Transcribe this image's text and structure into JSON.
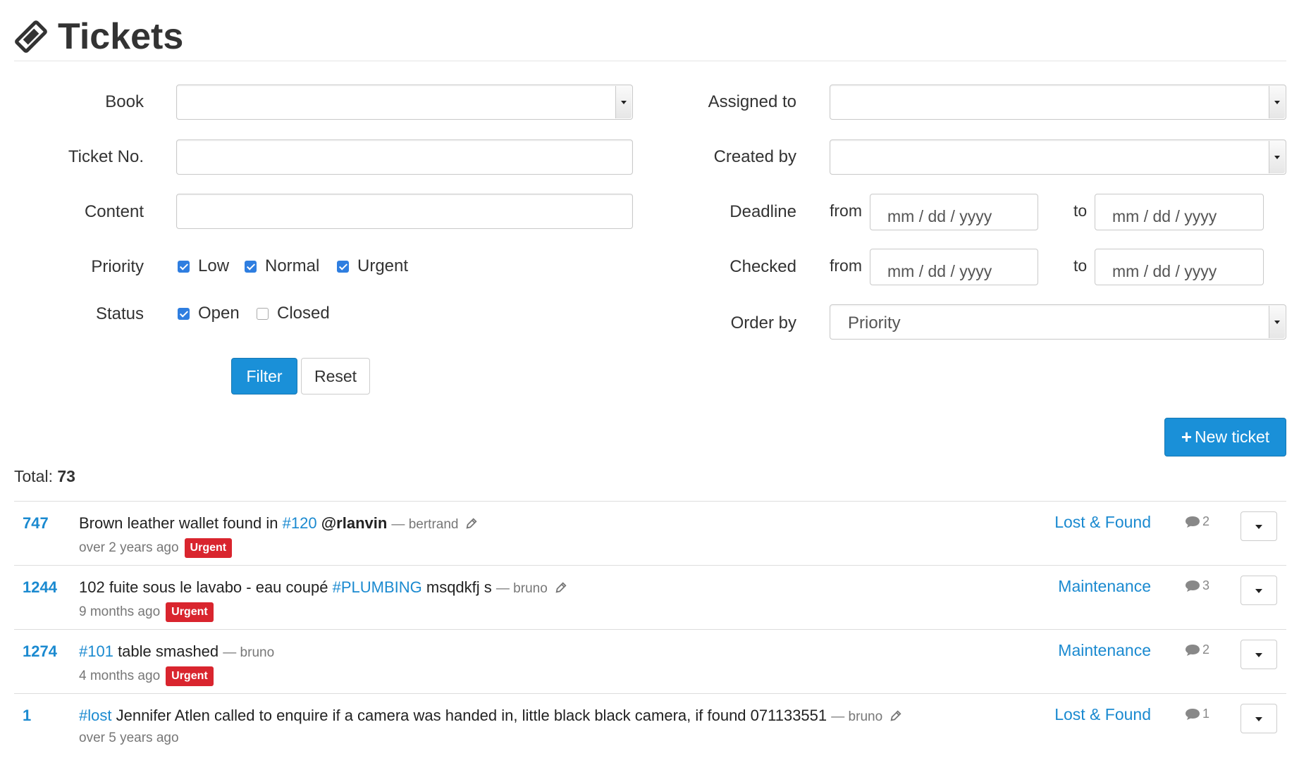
{
  "header": {
    "title": "Tickets",
    "icon": "ticket-icon"
  },
  "filters": {
    "book_label": "Book",
    "ticket_no_label": "Ticket No.",
    "content_label": "Content",
    "priority_label": "Priority",
    "status_label": "Status",
    "assigned_to_label": "Assigned to",
    "created_by_label": "Created by",
    "deadline_label": "Deadline",
    "checked_label": "Checked",
    "order_by_label": "Order by",
    "order_by_value": "Priority",
    "from_label": "from",
    "to_label": "to",
    "date_placeholder": "mm / dd / yyyy",
    "priority_options": [
      {
        "label": "Low",
        "checked": true
      },
      {
        "label": "Normal",
        "checked": true
      },
      {
        "label": "Urgent",
        "checked": true
      }
    ],
    "status_options": [
      {
        "label": "Open",
        "checked": true
      },
      {
        "label": "Closed",
        "checked": false
      }
    ],
    "filter_button": "Filter",
    "reset_button": "Reset"
  },
  "new_ticket_button": "New ticket",
  "total_label": "Total:",
  "total_value": "73",
  "tickets": [
    {
      "number": "747",
      "text": "Brown leather wallet found in ",
      "tag": "#120",
      "mention": "@rlanvin",
      "rest": "",
      "author": "— bertrand",
      "age": "over 2 years ago",
      "badge": "Urgent",
      "category": "Lost & Found",
      "comments": "2",
      "editable": true
    },
    {
      "number": "1244",
      "text": "102 fuite sous le lavabo - eau coupé ",
      "tag": "#PLUMBING",
      "mention": "",
      "rest": " msqdkfj s",
      "author": "— bruno",
      "age": "9 months ago",
      "badge": "Urgent",
      "category": "Maintenance",
      "comments": "3",
      "editable": true
    },
    {
      "number": "1274",
      "text": "",
      "tag": "#101",
      "mention": "",
      "rest": " table smashed",
      "author": "— bruno",
      "age": "4 months ago",
      "badge": "Urgent",
      "category": "Maintenance",
      "comments": "2",
      "editable": false
    },
    {
      "number": "1",
      "text": "",
      "tag": "#lost",
      "mention": "",
      "rest": " Jennifer Atlen called to enquire if a camera was handed in, little black black camera, if found 071133551",
      "author": "— bruno",
      "age": "over 5 years ago",
      "badge": "",
      "category": "Lost & Found",
      "comments": "1",
      "editable": true
    }
  ],
  "colors": {
    "accent": "#1a90d8",
    "urgent": "#d9252e",
    "link": "#1b8ad0"
  }
}
